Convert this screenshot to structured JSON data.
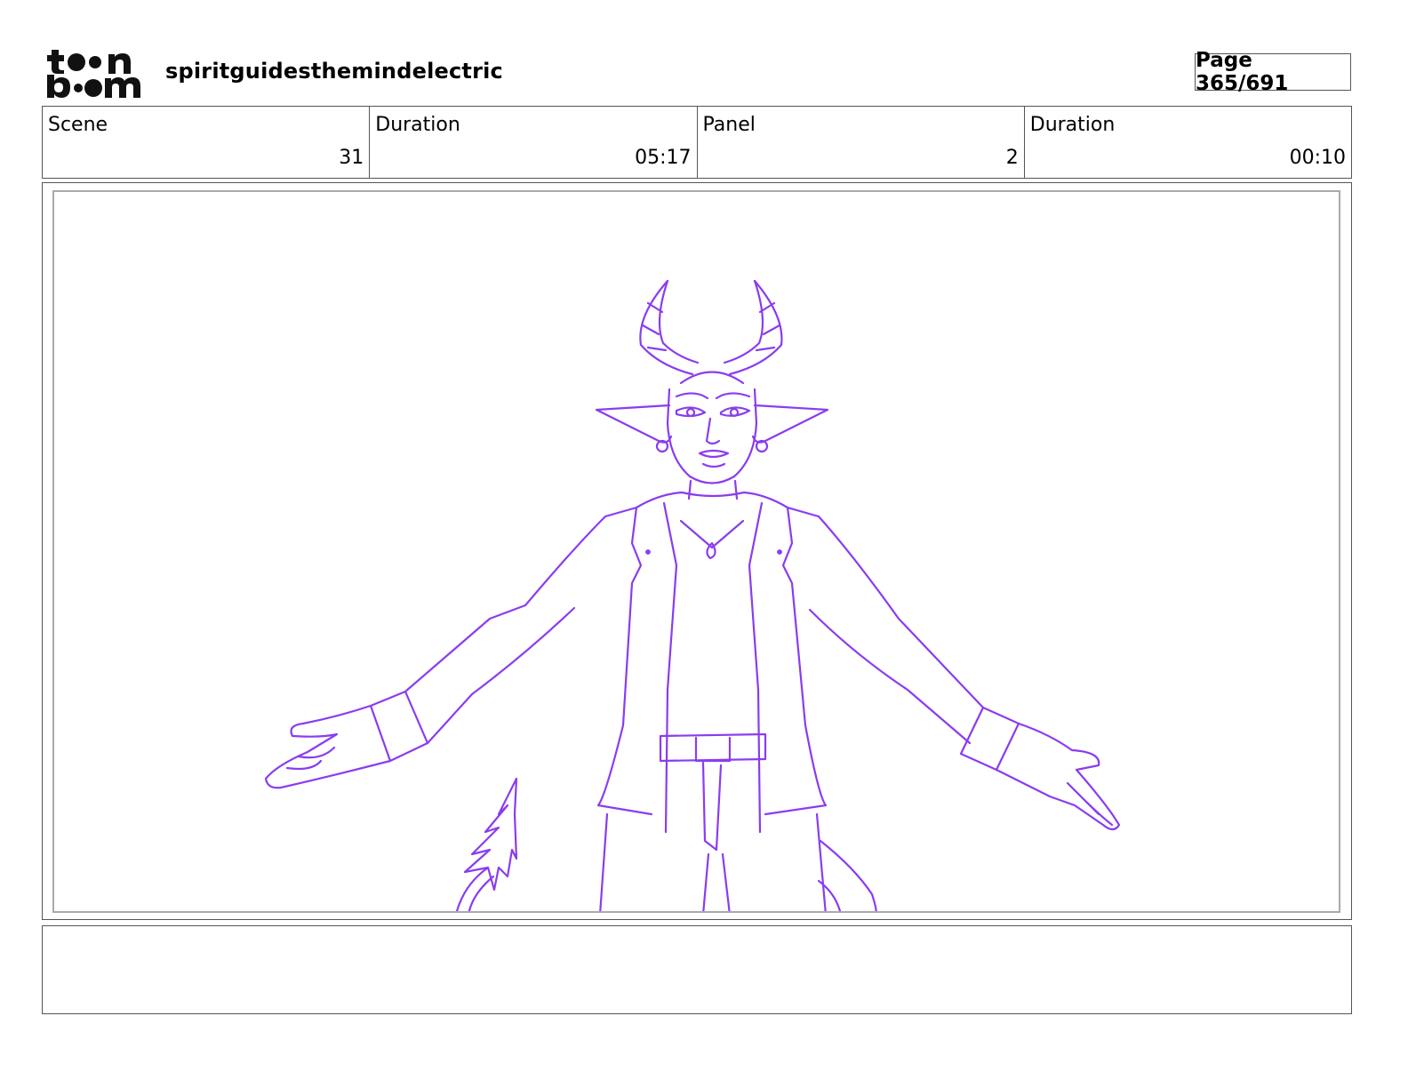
{
  "header": {
    "logo_text_top": "toon",
    "logo_text_bottom": "boom",
    "project_title": "spiritguidesthemindelectric",
    "page_label": "Page 365/691"
  },
  "info": {
    "scene_label": "Scene",
    "scene_value": "31",
    "scene_duration_label": "Duration",
    "scene_duration_value": "05:17",
    "panel_label": "Panel",
    "panel_value": "2",
    "panel_duration_label": "Duration",
    "panel_duration_value": "00:10"
  },
  "panel": {
    "sketch_color": "#8a3cf0"
  },
  "notes": {
    "text": ""
  }
}
